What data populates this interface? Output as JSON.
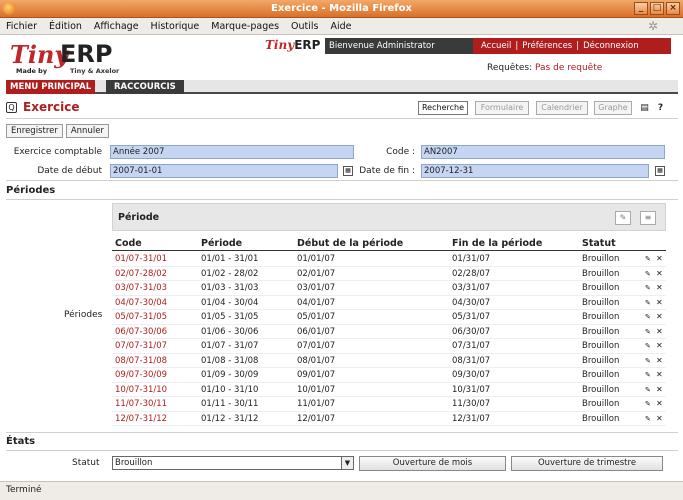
{
  "window": {
    "title": "Exercice - Mozilla Firefox"
  },
  "menubar": [
    "Fichier",
    "Édition",
    "Affichage",
    "Historique",
    "Marque-pages",
    "Outils",
    "Aide"
  ],
  "brand": {
    "tiny": "Tiny",
    "erp": "ERP",
    "madeby": "Made by",
    "axelor": "Tiny & Axelor"
  },
  "top": {
    "welcome": "Bienvenue Administrator",
    "nav": [
      "Accueil",
      "Préférences",
      "Déconnexion"
    ],
    "requests_label": "Requêtes:",
    "requests_value": "Pas de requête"
  },
  "mainmenu": {
    "main": "MENU PRINCIPAL",
    "shortcuts": "RACCOURCIS"
  },
  "header": {
    "title": "Exercice",
    "views": [
      "Recherche",
      "Formulaire",
      "Calendrier",
      "Graphe"
    ]
  },
  "actions": {
    "save": "Enregistrer",
    "cancel": "Annuler"
  },
  "form": {
    "fiscal_year_label": "Exercice comptable",
    "fiscal_year": "Année 2007",
    "code_label": "Code :",
    "code": "AN2007",
    "start_label": "Date de début",
    "start": "2007-01-01",
    "end_label": "Date de fin :",
    "end": "2007-12-31"
  },
  "periods": {
    "section": "Périodes",
    "label": "Périodes",
    "panel_title": "Période",
    "columns": [
      "Code",
      "Période",
      "Début de la période",
      "Fin de la période",
      "Statut"
    ],
    "rows": [
      [
        "01/07-31/01",
        "01/01 - 31/01",
        "01/01/07",
        "01/31/07",
        "Brouillon"
      ],
      [
        "02/07-28/02",
        "01/02 - 28/02",
        "02/01/07",
        "02/28/07",
        "Brouillon"
      ],
      [
        "03/07-31/03",
        "01/03 - 31/03",
        "03/01/07",
        "03/31/07",
        "Brouillon"
      ],
      [
        "04/07-30/04",
        "01/04 - 30/04",
        "04/01/07",
        "04/30/07",
        "Brouillon"
      ],
      [
        "05/07-31/05",
        "01/05 - 31/05",
        "05/01/07",
        "05/31/07",
        "Brouillon"
      ],
      [
        "06/07-30/06",
        "01/06 - 30/06",
        "06/01/07",
        "06/30/07",
        "Brouillon"
      ],
      [
        "07/07-31/07",
        "01/07 - 31/07",
        "07/01/07",
        "07/31/07",
        "Brouillon"
      ],
      [
        "08/07-31/08",
        "01/08 - 31/08",
        "08/01/07",
        "08/31/07",
        "Brouillon"
      ],
      [
        "09/07-30/09",
        "01/09 - 30/09",
        "09/01/07",
        "09/30/07",
        "Brouillon"
      ],
      [
        "10/07-31/10",
        "01/10 - 31/10",
        "10/01/07",
        "10/31/07",
        "Brouillon"
      ],
      [
        "11/07-30/11",
        "01/11 - 30/11",
        "11/01/07",
        "11/30/07",
        "Brouillon"
      ],
      [
        "12/07-31/12",
        "01/12 - 31/12",
        "12/01/07",
        "12/31/07",
        "Brouillon"
      ]
    ]
  },
  "states": {
    "section": "États",
    "statut_label": "Statut",
    "statut_value": "Brouillon",
    "open_periods": "Ouverture de mois",
    "open_quarters": "Ouverture de trimestre"
  },
  "statusbar": "Terminé"
}
